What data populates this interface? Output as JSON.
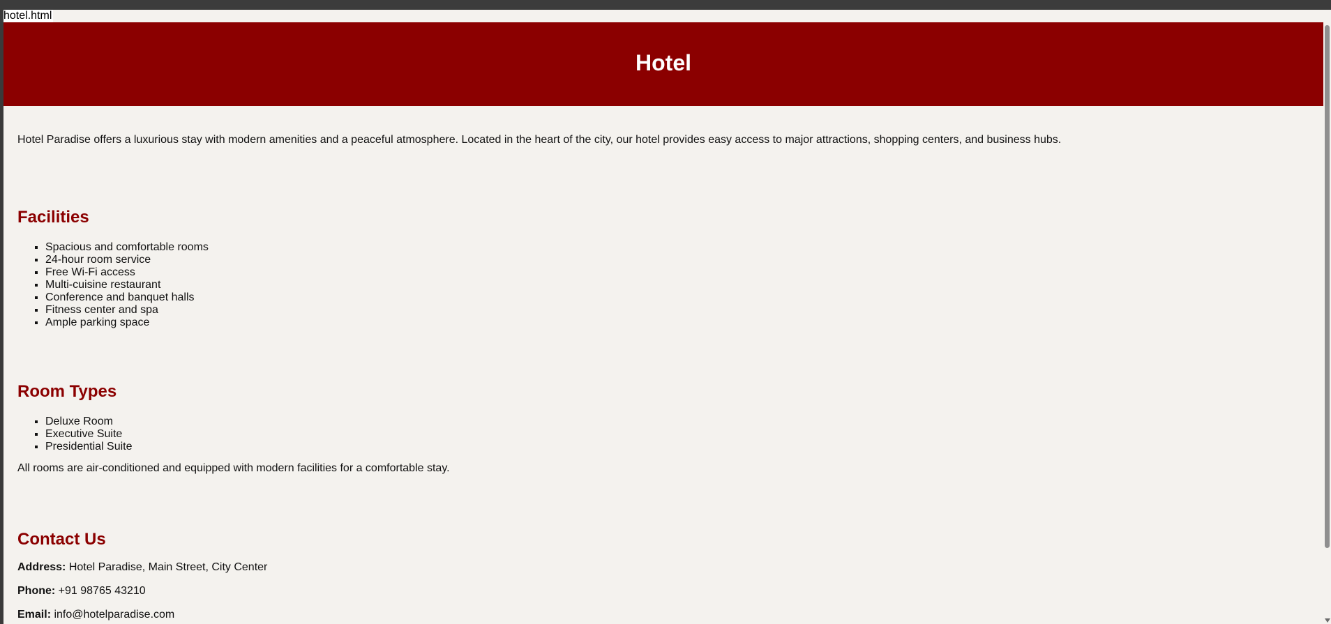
{
  "page": {
    "filename": "hotel.html",
    "title": "Hotel",
    "intro": "Hotel Paradise offers a luxurious stay with modern amenities and a peaceful atmosphere. Located in the heart of the city, our hotel provides easy access to major attractions, shopping centers, and business hubs."
  },
  "facilities": {
    "heading": "Facilities",
    "items": [
      "Spacious and comfortable rooms",
      "24-hour room service",
      "Free Wi-Fi access",
      "Multi-cuisine restaurant",
      "Conference and banquet halls",
      "Fitness center and spa",
      "Ample parking space"
    ]
  },
  "rooms": {
    "heading": "Room Types",
    "items": [
      "Deluxe Room",
      "Executive Suite",
      "Presidential Suite"
    ],
    "note": "All rooms are air-conditioned and equipped with modern facilities for a comfortable stay."
  },
  "contact": {
    "heading": "Contact Us",
    "address_label": "Address:",
    "address": "Hotel Paradise, Main Street, City Center",
    "phone_label": "Phone:",
    "phone": "+91 98765 43210",
    "email_label": "Email:",
    "email": "info@hotelparadise.com"
  },
  "colors": {
    "header_bg": "#8b0000",
    "heading_color": "#8b0000",
    "page_bg": "#f4f2ee"
  }
}
